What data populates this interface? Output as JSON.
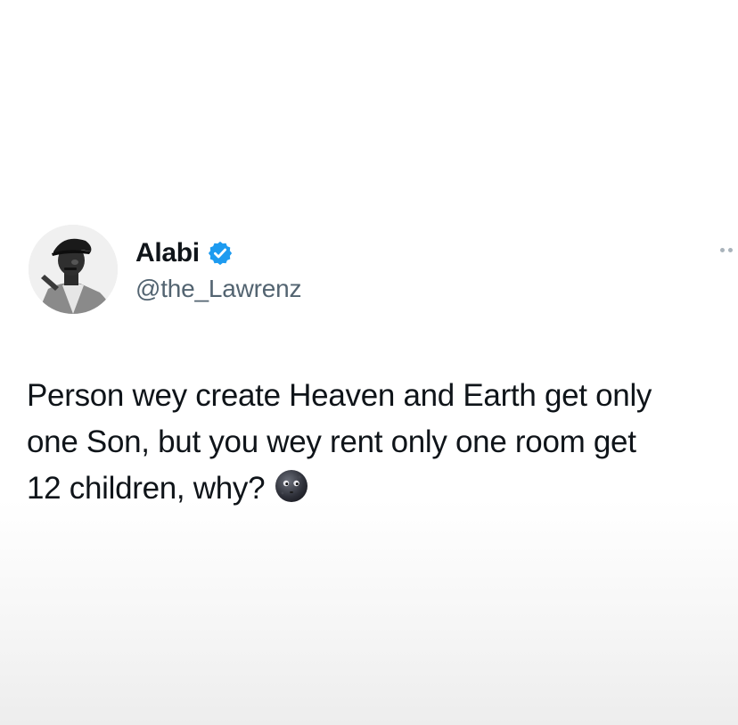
{
  "tweet": {
    "author": {
      "display_name": "Alabi",
      "handle": "@the_Lawrenz",
      "verified": true,
      "verified_color": "#1d9bf0"
    },
    "more_icon": "more-options-icon",
    "text_lines": [
      "Person wey create Heaven and Earth get only",
      "one Son, but you wey rent only one room get",
      "12 children, why?"
    ],
    "emoji": "new-moon-face"
  }
}
